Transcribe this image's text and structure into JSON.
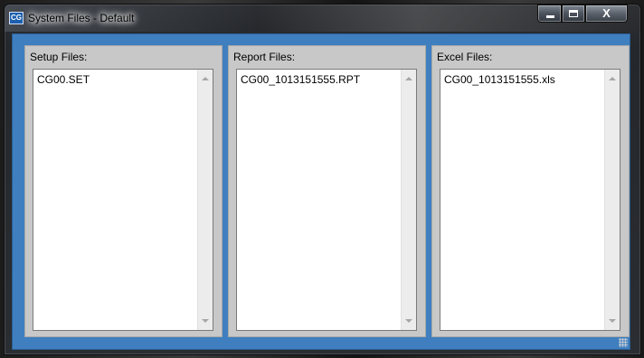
{
  "window": {
    "app_icon_text": "CG",
    "title": "System Files - Default",
    "controls": {
      "minimize": "minimize-icon",
      "maximize": "maximize-icon",
      "close_label": "X"
    }
  },
  "panels": [
    {
      "label": "Setup Files:",
      "items": [
        "CG00.SET"
      ]
    },
    {
      "label": "Report Files:",
      "items": [
        "CG00_1013151555.RPT"
      ]
    },
    {
      "label": "Excel Files:",
      "items": [
        "CG00_1013151555.xls"
      ]
    }
  ],
  "colors": {
    "client_background": "#3f7fbf",
    "panel_background": "#c8c8c8",
    "list_background": "#ffffff"
  }
}
